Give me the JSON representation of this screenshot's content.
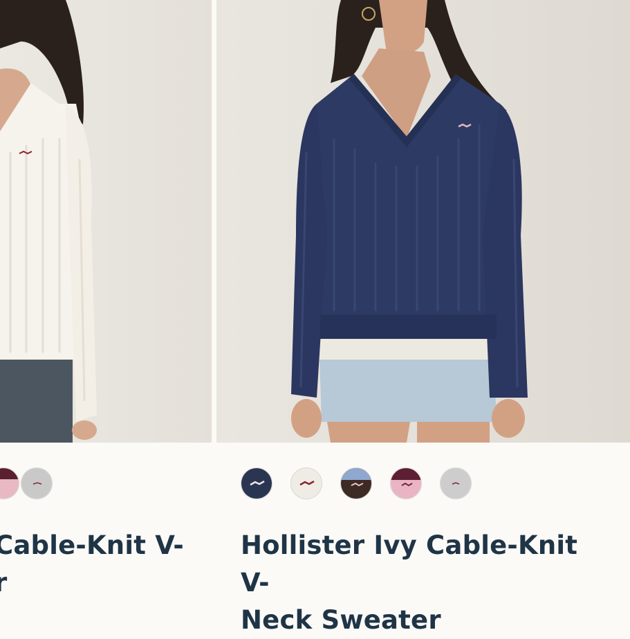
{
  "products": [
    {
      "title_line1": "Cable-Knit V-",
      "title_line2": "r",
      "image_alt": "Hollister Ivy Cable-Knit V-Neck Sweater in cream",
      "swatches": [
        {
          "name": "pink",
          "color": "#e8b9c2"
        },
        {
          "name": "grey",
          "color": "#c9c9c9"
        }
      ]
    },
    {
      "title_line1": "Hollister Ivy Cable-Knit V-",
      "title_line2": "Neck Sweater",
      "image_alt": "Hollister Ivy Cable-Knit V-Neck Sweater in navy",
      "swatches": [
        {
          "name": "navy",
          "color": "#2a3552"
        },
        {
          "name": "cream",
          "color": "#efece6"
        },
        {
          "name": "light-blue-brown",
          "color": "#8ea8cf"
        },
        {
          "name": "burgundy-pink",
          "color": "#e9b5c4"
        },
        {
          "name": "grey",
          "color": "#cdcdcd"
        }
      ]
    }
  ],
  "colors": {
    "title": "#1f3447",
    "background": "#fbfaf6",
    "sweater_navy": "#2d3a63",
    "sweater_cream": "#f6f3ec"
  }
}
